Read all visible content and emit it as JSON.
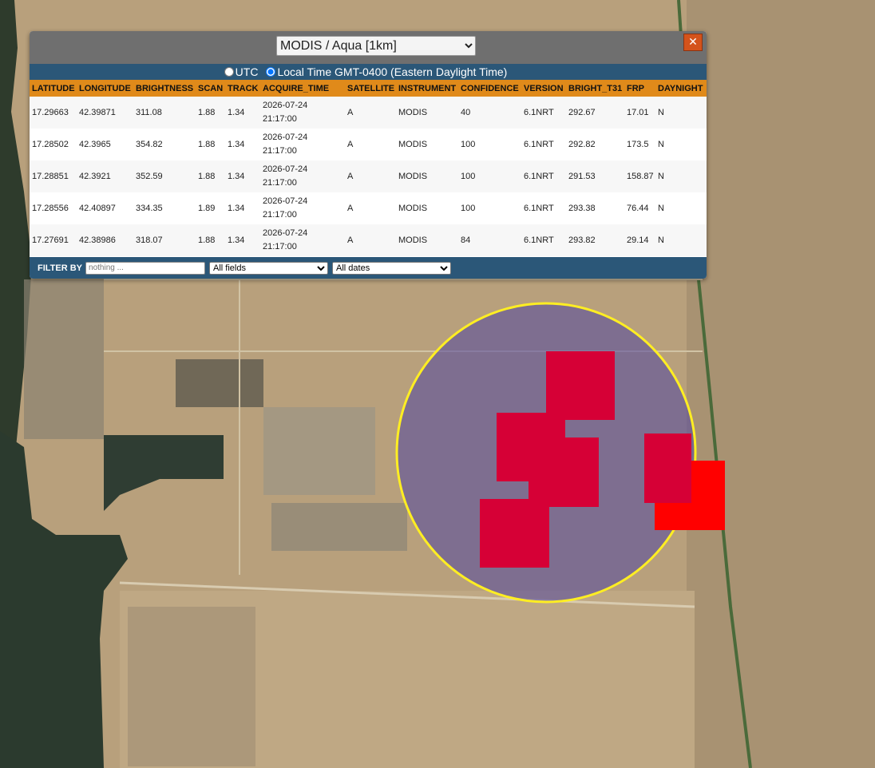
{
  "popup": {
    "source_selected": "MODIS / Aqua [1km]",
    "close_glyph": "✕",
    "tz_utc_label": "UTC",
    "tz_local_label": "Local Time GMT-0400 (Eastern Daylight Time)",
    "tz_selected": "local"
  },
  "table": {
    "columns": [
      "LATITUDE",
      "LONGITUDE",
      "BRIGHTNESS",
      "SCAN",
      "TRACK",
      "ACQUIRE_TIME",
      "SATELLITE",
      "INSTRUMENT",
      "CONFIDENCE",
      "VERSION",
      "BRIGHT_T31",
      "FRP",
      "DAYNIGHT"
    ],
    "rows": [
      {
        "latitude": "17.29663",
        "longitude": "42.39871",
        "brightness": "311.08",
        "scan": "1.88",
        "track": "1.34",
        "acquire_date": "2026-07-24",
        "acquire_time": "21:17:00",
        "satellite": "A",
        "instrument": "MODIS",
        "confidence": "40",
        "version": "6.1NRT",
        "bright_t31": "292.67",
        "frp": "17.01",
        "daynight": "N"
      },
      {
        "latitude": "17.28502",
        "longitude": "42.3965",
        "brightness": "354.82",
        "scan": "1.88",
        "track": "1.34",
        "acquire_date": "2026-07-24",
        "acquire_time": "21:17:00",
        "satellite": "A",
        "instrument": "MODIS",
        "confidence": "100",
        "version": "6.1NRT",
        "bright_t31": "292.82",
        "frp": "173.5",
        "daynight": "N"
      },
      {
        "latitude": "17.28851",
        "longitude": "42.3921",
        "brightness": "352.59",
        "scan": "1.88",
        "track": "1.34",
        "acquire_date": "2026-07-24",
        "acquire_time": "21:17:00",
        "satellite": "A",
        "instrument": "MODIS",
        "confidence": "100",
        "version": "6.1NRT",
        "bright_t31": "291.53",
        "frp": "158.87",
        "daynight": "N"
      },
      {
        "latitude": "17.28556",
        "longitude": "42.40897",
        "brightness": "334.35",
        "scan": "1.89",
        "track": "1.34",
        "acquire_date": "2026-07-24",
        "acquire_time": "21:17:00",
        "satellite": "A",
        "instrument": "MODIS",
        "confidence": "100",
        "version": "6.1NRT",
        "bright_t31": "293.38",
        "frp": "76.44",
        "daynight": "N"
      },
      {
        "latitude": "17.27691",
        "longitude": "42.38986",
        "brightness": "318.07",
        "scan": "1.88",
        "track": "1.34",
        "acquire_date": "2026-07-24",
        "acquire_time": "21:17:00",
        "satellite": "A",
        "instrument": "MODIS",
        "confidence": "84",
        "version": "6.1NRT",
        "bright_t31": "293.82",
        "frp": "29.14",
        "daynight": "N"
      }
    ]
  },
  "filter": {
    "label": "FILTER BY",
    "placeholder": "nothing ...",
    "field_selected": "All fields",
    "date_selected": "All dates"
  },
  "map": {
    "selection_ring_color": "#ffee22",
    "selection_fill_color": "#5a4f9c",
    "hotspot_color": "#d60036",
    "hotspot_outside_color": "#ff0000"
  }
}
